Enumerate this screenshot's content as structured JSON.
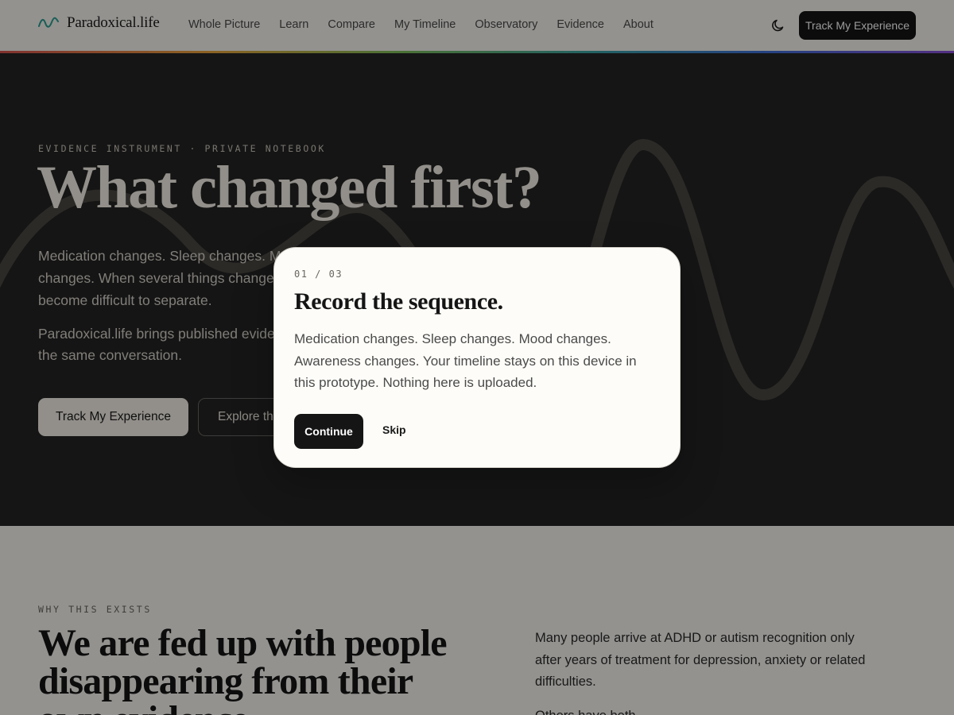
{
  "header": {
    "brand": "Paradoxical.life",
    "nav": [
      {
        "label": "Whole Picture"
      },
      {
        "label": "Learn"
      },
      {
        "label": "Compare"
      },
      {
        "label": "My Timeline"
      },
      {
        "label": "Observatory"
      },
      {
        "label": "Evidence"
      },
      {
        "label": "About"
      }
    ],
    "theme_icon": "moon-icon",
    "cta_label": "Track My Experience"
  },
  "hero": {
    "eyebrow": "EVIDENCE INSTRUMENT · PRIVATE NOTEBOOK",
    "title": "What changed first?",
    "lead": "Medication changes. Sleep changes. Mood changes. Awareness changes. When several things change at once, cause and effect can become difficult to separate.",
    "sub": "Paradoxical.life brings published evidence and your own timeline into the same conversation.",
    "primary_cta": "Track My Experience",
    "secondary_cta": "Explore the evidence"
  },
  "why": {
    "eyebrow": "WHY THIS EXISTS",
    "title": "We are fed up with people disappearing from their own evidence.",
    "text": "Many people arrive at ADHD or autism recognition only after years of treatment for depression, anxiety or related difficulties.",
    "text2": "Others have both."
  },
  "modal": {
    "step": "01 / 03",
    "title": "Record the sequence.",
    "body": "Medication changes. Sleep changes. Mood changes. Awareness changes. Your timeline stays on this device in this prototype. Nothing here is uploaded.",
    "continue_label": "Continue",
    "skip_label": "Skip"
  },
  "colors": {
    "ink": "#151515",
    "hero_bg": "#232323",
    "paper": "#f6f3ee",
    "accent_logo": "#2a9d8f"
  }
}
